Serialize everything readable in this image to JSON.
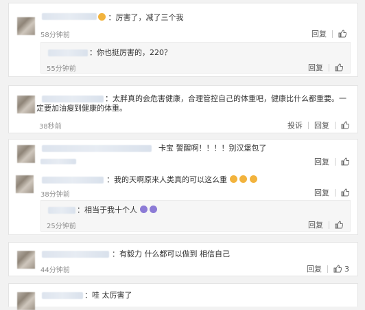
{
  "comments": [
    {
      "text": "：厉害了，减了三个我",
      "time": "58分钟前",
      "reply_label": "回复",
      "likes": "",
      "reply": {
        "text": "：你也挺厉害的，220？",
        "time": "55分钟前",
        "reply_label": "回复",
        "likes": ""
      }
    },
    {
      "text": "：太胖真的会危害健康，合理管控自己的体重吧，健康比什么都重要。一定要加油瘦到健康的体重。",
      "time": "38秒前",
      "report_label": "投诉",
      "reply_label": "回复",
      "likes": ""
    },
    {
      "text": "卡宝 警醒啊！！！！别汉堡包了",
      "time": "",
      "reply_label": "回复",
      "likes": "",
      "sub": [
        {
          "text": "：我的天啊原来人类真的可以这么重",
          "time": "38分钟前",
          "reply_label": "回复",
          "likes": ""
        },
        {
          "text": "：相当于我十个人",
          "time": "25分钟前",
          "reply_label": "回复",
          "likes": ""
        }
      ]
    },
    {
      "text": "：有毅力 什么都可以做到 相信自己",
      "time": "44分钟前",
      "reply_label": "回复",
      "likes": "3"
    },
    {
      "text": "：哇 太厉害了",
      "time": "",
      "reply_label": "",
      "likes": ""
    }
  ],
  "colors": {
    "accent_emoji": "#f2b33d",
    "link": "#333333"
  },
  "icons": {
    "like": "thumbs-up-icon"
  }
}
